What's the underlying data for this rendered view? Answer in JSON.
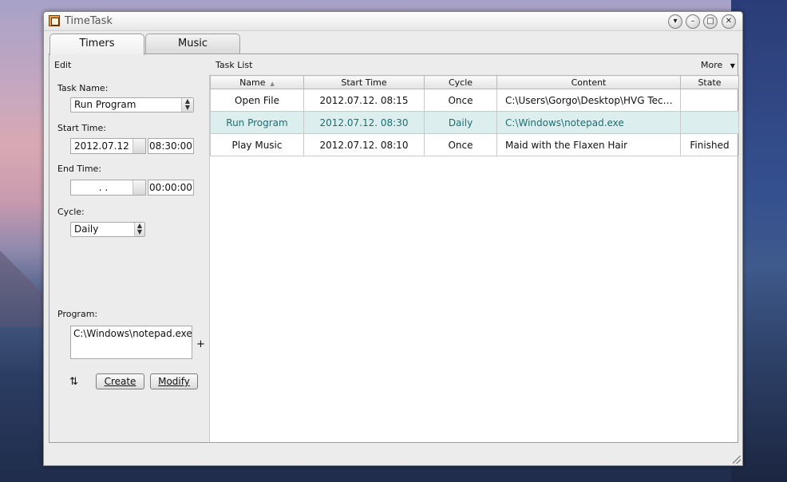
{
  "window": {
    "title": "TimeTask",
    "icon": "timetask-app-icon"
  },
  "window_controls": {
    "menu": "▾",
    "minimize": "–",
    "maximize": "□",
    "close": "✕"
  },
  "tabs": [
    {
      "label": "Timers",
      "active": true
    },
    {
      "label": "Music",
      "active": false
    }
  ],
  "edit": {
    "header": "Edit",
    "task_name_label": "Task Name:",
    "task_name_value": "Run Program",
    "start_time_label": "Start Time:",
    "start_date": "2012.07.12",
    "start_clock": "08:30:00",
    "end_time_label": "End Time:",
    "end_date": ". .",
    "end_clock": "00:00:00",
    "cycle_label": "Cycle:",
    "cycle_value": "Daily",
    "program_label": "Program:",
    "program_value": "C:\\Windows\\notepad.exe",
    "add_symbol": "+",
    "refresh_icon": "refresh-icon",
    "create_label": "Create",
    "modify_label": "Modify"
  },
  "task_list": {
    "header": "Task List",
    "more_label": "More",
    "columns": [
      "Name",
      "Start Time",
      "Cycle",
      "Content",
      "State"
    ],
    "rows": [
      {
        "name": "Open File",
        "start": "2012.07.12. 08:15",
        "cycle": "Once",
        "content": "C:\\Users\\Gorgo\\Desktop\\HVG Tech ci...",
        "state": ""
      },
      {
        "name": "Run Program",
        "start": "2012.07.12. 08:30",
        "cycle": "Daily",
        "content": "C:\\Windows\\notepad.exe",
        "state": "",
        "selected": true
      },
      {
        "name": "Play Music",
        "start": "2012.07.12. 08:10",
        "cycle": "Once",
        "content": "Maid with the Flaxen Hair",
        "state": "Finished"
      }
    ]
  }
}
